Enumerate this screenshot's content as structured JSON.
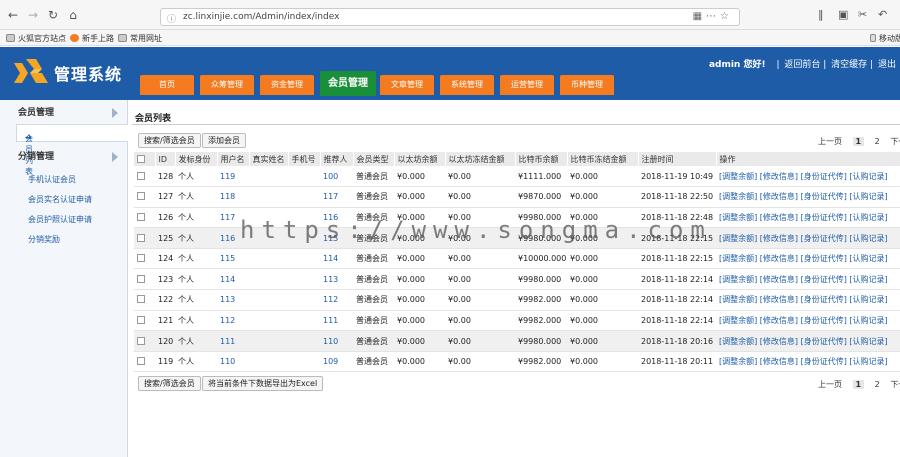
{
  "browser": {
    "url": "zc.linxinjie.com/Admin/index/index",
    "bookmarks": [
      "火狐官方站点",
      "新手上路",
      "常用网址"
    ],
    "mobile_bookmark": "移动版"
  },
  "header": {
    "app_title": "管理系统",
    "user_greeting": "admin 您好!",
    "links": [
      "返回前台",
      "清空缓存",
      "退出"
    ],
    "tabs": [
      "首页",
      "众筹管理",
      "资金管理",
      "会员管理",
      "文章管理",
      "系统管理",
      "运营管理",
      "币种管理"
    ],
    "active_tab": "会员管理"
  },
  "sidebar": {
    "group1": "会员管理",
    "group1_items": [
      "会员列表"
    ],
    "group2": "分销管理",
    "group2_items": [
      "手机认证会员",
      "会员实名认证申请",
      "会员护照认证申请",
      "分销奖励"
    ]
  },
  "main": {
    "title": "会员列表",
    "search_button": "搜索/筛选会员",
    "add_button": "添加会员",
    "export_button": "将当前条件下数据导出为Excel",
    "pager": {
      "prev": "上一页",
      "pages": [
        "1",
        "2"
      ],
      "next": "下一页",
      "current": "1"
    },
    "columns": [
      "ID",
      "发标身份",
      "用户名",
      "真实姓名",
      "手机号",
      "推荐人",
      "会员类型",
      "以太坊余额",
      "以太坊冻结金额",
      "比特币余额",
      "比特币冻结金额",
      "注册时间",
      "操作"
    ],
    "ops": [
      "[调整余额]",
      "[修改信息]",
      "[身份证代传]",
      "[认购记录]"
    ],
    "rows": [
      {
        "id": "128",
        "role": "个人",
        "user": "119",
        "name": "",
        "phone": "",
        "ref": "100",
        "type": "普通会员",
        "eth": "¥0.000",
        "eth_frozen": "¥0.00",
        "btc": "¥1111.000",
        "btc_frozen": "¥0.000",
        "reg": "2018-11-19 10:49"
      },
      {
        "id": "127",
        "role": "个人",
        "user": "118",
        "name": "",
        "phone": "",
        "ref": "117",
        "type": "普通会员",
        "eth": "¥0.000",
        "eth_frozen": "¥0.00",
        "btc": "¥9870.000",
        "btc_frozen": "¥0.000",
        "reg": "2018-11-18 22:50"
      },
      {
        "id": "126",
        "role": "个人",
        "user": "117",
        "name": "",
        "phone": "",
        "ref": "116",
        "type": "普通会员",
        "eth": "¥0.000",
        "eth_frozen": "¥0.00",
        "btc": "¥9980.000",
        "btc_frozen": "¥0.000",
        "reg": "2018-11-18 22:48"
      },
      {
        "id": "125",
        "role": "个人",
        "user": "116",
        "name": "",
        "phone": "",
        "ref": "115",
        "type": "普通会员",
        "eth": "¥0.000",
        "eth_frozen": "¥0.00",
        "btc": "¥9980.000",
        "btc_frozen": "¥0.000",
        "reg": "2018-11-18 22:15"
      },
      {
        "id": "124",
        "role": "个人",
        "user": "115",
        "name": "",
        "phone": "",
        "ref": "114",
        "type": "普通会员",
        "eth": "¥0.000",
        "eth_frozen": "¥0.00",
        "btc": "¥10000.000",
        "btc_frozen": "¥0.000",
        "reg": "2018-11-18 22:15"
      },
      {
        "id": "123",
        "role": "个人",
        "user": "114",
        "name": "",
        "phone": "",
        "ref": "113",
        "type": "普通会员",
        "eth": "¥0.000",
        "eth_frozen": "¥0.00",
        "btc": "¥9980.000",
        "btc_frozen": "¥0.000",
        "reg": "2018-11-18 22:14"
      },
      {
        "id": "122",
        "role": "个人",
        "user": "113",
        "name": "",
        "phone": "",
        "ref": "112",
        "type": "普通会员",
        "eth": "¥0.000",
        "eth_frozen": "¥0.00",
        "btc": "¥9982.000",
        "btc_frozen": "¥0.000",
        "reg": "2018-11-18 22:14"
      },
      {
        "id": "121",
        "role": "个人",
        "user": "112",
        "name": "",
        "phone": "",
        "ref": "111",
        "type": "普通会员",
        "eth": "¥0.000",
        "eth_frozen": "¥0.00",
        "btc": "¥9982.000",
        "btc_frozen": "¥0.000",
        "reg": "2018-11-18 22:14"
      },
      {
        "id": "120",
        "role": "个人",
        "user": "111",
        "name": "",
        "phone": "",
        "ref": "110",
        "type": "普通会员",
        "eth": "¥0.000",
        "eth_frozen": "¥0.00",
        "btc": "¥9980.000",
        "btc_frozen": "¥0.000",
        "reg": "2018-11-18 20:16"
      },
      {
        "id": "119",
        "role": "个人",
        "user": "110",
        "name": "",
        "phone": "",
        "ref": "109",
        "type": "普通会员",
        "eth": "¥0.000",
        "eth_frozen": "¥0.00",
        "btc": "¥9982.000",
        "btc_frozen": "¥0.000",
        "reg": "2018-11-18 20:11"
      }
    ]
  },
  "watermark": "https://www.songma.com"
}
